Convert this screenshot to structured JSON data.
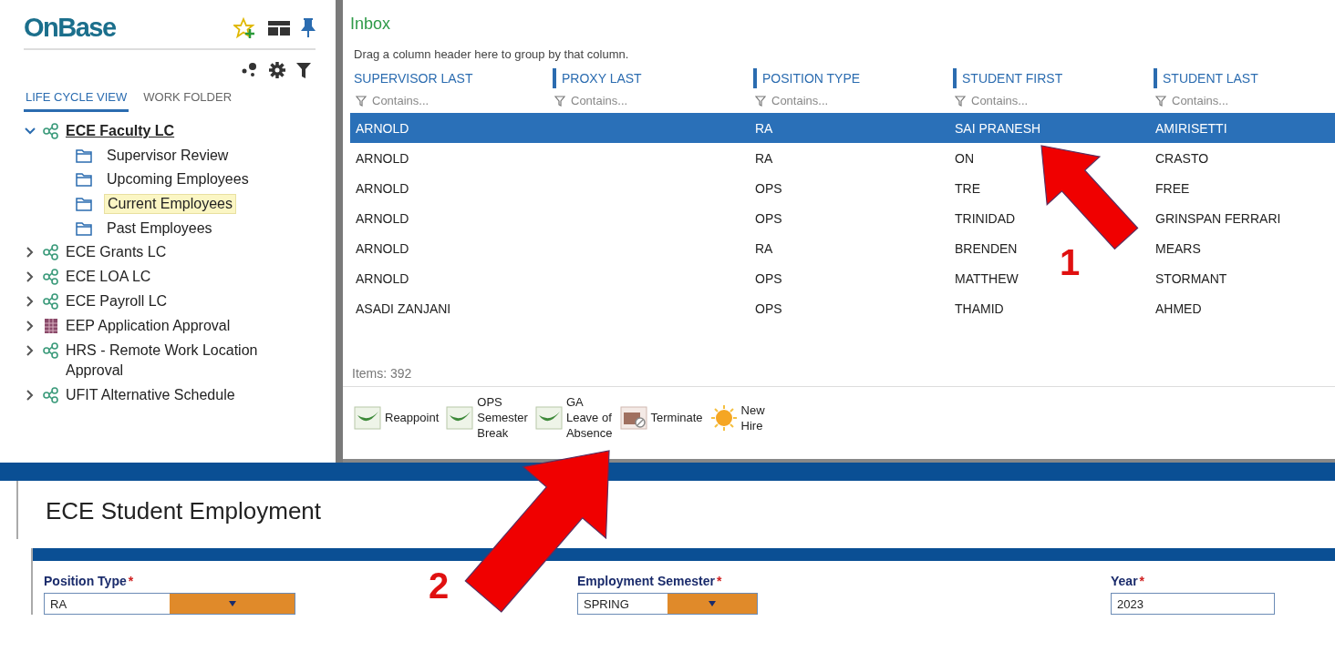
{
  "sidebar": {
    "logo": "OnBase",
    "tabs": [
      {
        "label": "LIFE CYCLE VIEW",
        "selected": true
      },
      {
        "label": "WORK FOLDER",
        "selected": false
      }
    ],
    "tree": [
      {
        "label": "ECE Faculty LC",
        "kind": "lifecycle",
        "expanded": true,
        "selected": true,
        "children": [
          {
            "label": "Supervisor Review",
            "kind": "folder",
            "selected": false
          },
          {
            "label": "Upcoming Employees",
            "kind": "folder",
            "selected": false
          },
          {
            "label": "Current Employees",
            "kind": "folder",
            "selected": true
          },
          {
            "label": "Past Employees",
            "kind": "folder",
            "selected": false
          }
        ]
      },
      {
        "label": "ECE Grants LC",
        "kind": "lifecycle",
        "expanded": false,
        "selected": false
      },
      {
        "label": "ECE LOA LC",
        "kind": "lifecycle",
        "expanded": false,
        "selected": false
      },
      {
        "label": "ECE Payroll LC",
        "kind": "lifecycle",
        "expanded": false,
        "selected": false
      },
      {
        "label": "EEP Application Approval",
        "kind": "application",
        "expanded": false,
        "selected": false
      },
      {
        "label": "HRS - Remote Work Location Approval",
        "kind": "lifecycle",
        "expanded": false,
        "selected": false
      },
      {
        "label": "UFIT Alternative Schedule",
        "kind": "lifecycle",
        "expanded": false,
        "selected": false
      }
    ]
  },
  "inbox": {
    "title": "Inbox",
    "group_hint": "Drag a column header here to group by that column.",
    "columns": [
      {
        "label": "SUPERVISOR LAST",
        "placeholder": "Contains..."
      },
      {
        "label": "PROXY LAST",
        "placeholder": "Contains..."
      },
      {
        "label": "POSITION TYPE",
        "placeholder": "Contains..."
      },
      {
        "label": "STUDENT FIRST",
        "placeholder": "Contains..."
      },
      {
        "label": "STUDENT LAST",
        "placeholder": "Contains..."
      }
    ],
    "rows": [
      {
        "cells": [
          "ARNOLD",
          null,
          "RA",
          "SAI PRANESH",
          "AMIRISETTI"
        ],
        "selected": true
      },
      {
        "cells": [
          "ARNOLD",
          null,
          "RA",
          "ON",
          "CRASTO"
        ],
        "selected": false
      },
      {
        "cells": [
          "ARNOLD",
          null,
          "OPS",
          "TRE",
          "FREE"
        ],
        "selected": false
      },
      {
        "cells": [
          "ARNOLD",
          null,
          "OPS",
          "TRINIDAD",
          "GRINSPAN FERRARI"
        ],
        "selected": false
      },
      {
        "cells": [
          "ARNOLD",
          null,
          "RA",
          "BRENDEN",
          "MEARS"
        ],
        "selected": false
      },
      {
        "cells": [
          "ARNOLD",
          null,
          "OPS",
          "MATTHEW",
          "STORMANT"
        ],
        "selected": false
      },
      {
        "cells": [
          "ASADI ZANJANI",
          null,
          "OPS",
          "THAMID",
          "AHMED"
        ],
        "selected": false
      }
    ],
    "items_count": "Items: 392",
    "actions": [
      {
        "label": "Reappoint",
        "kind": "check"
      },
      {
        "label": "OPS\nSemester\nBreak",
        "kind": "check"
      },
      {
        "label": "GA\nLeave of\nAbsence",
        "kind": "check"
      },
      {
        "label": "Terminate",
        "kind": "terminate"
      },
      {
        "label": "New\nHire",
        "kind": "sun"
      }
    ]
  },
  "form": {
    "title": "ECE Student Employment",
    "required_mark": "*",
    "fields": [
      {
        "label": "Position Type",
        "required": true,
        "value": "RA",
        "kind": "dropdown"
      },
      {
        "label": "Employment Semester",
        "required": true,
        "value": "SPRING",
        "kind": "dropdown"
      },
      {
        "label": "Year",
        "required": true,
        "value": "2023",
        "kind": "text"
      }
    ]
  },
  "annotations": [
    {
      "label": "1"
    },
    {
      "label": "2"
    }
  ]
}
